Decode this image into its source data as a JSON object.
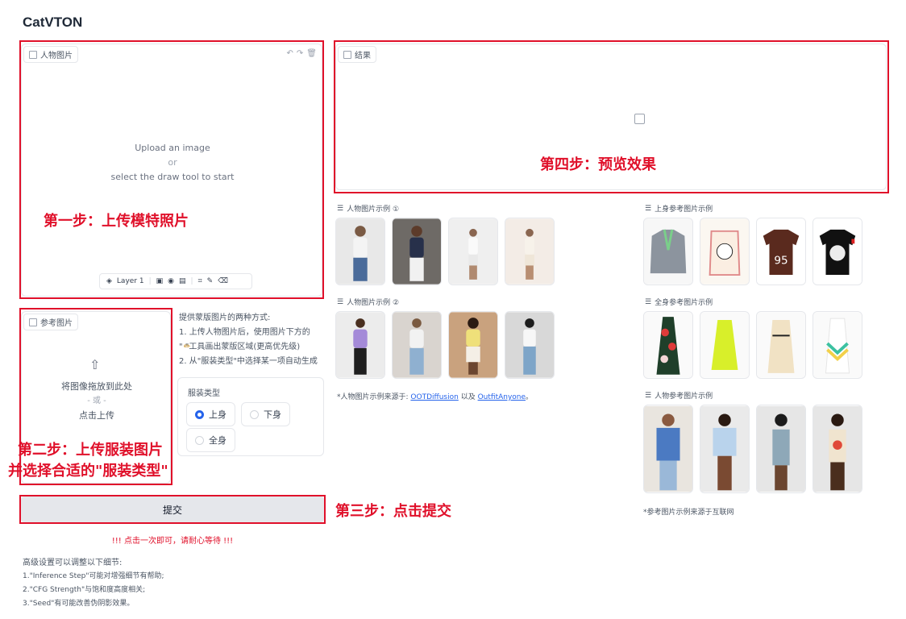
{
  "app": {
    "title": "CatVTON"
  },
  "person_panel": {
    "label": "人物图片",
    "upload_line1": "Upload an image",
    "upload_or": "or",
    "upload_line2": "select the draw tool to start",
    "layer_label": "Layer 1"
  },
  "result_panel": {
    "label": "结果"
  },
  "cloth_panel": {
    "label": "参考图片",
    "drop_text": "将图像拖放到此处",
    "or_text": "- 或 -",
    "click_text": "点击上传"
  },
  "mask_help": {
    "line1": "提供蒙版图片的两种方式:",
    "line2": "1. 上传人物图片后，使用图片下方的",
    "line3": "\"  \"工具画出蒙版区域(更高优先级)",
    "line4": "2. 从\"服装类型\"中选择某一项自动生成"
  },
  "cloth_type": {
    "label": "服装类型",
    "options": [
      "上身",
      "下身",
      "全身"
    ],
    "selected": "上身"
  },
  "submit": {
    "label": "提交",
    "note": "!!! 点击一次即可，请耐心等待 !!!"
  },
  "advanced": {
    "line1": "高级设置可以调整以下细节:",
    "line2": "1.\"Inference Step\"可能对增强细节有帮助;",
    "line3": "2.\"CFG Strength\"与饱和度高度相关;",
    "line4": "3.\"Seed\"有可能改善伪阴影效果。"
  },
  "galleries": {
    "person1": "人物图片示例 ①",
    "person2": "人物图片示例 ②",
    "upper": "上身参考图片示例",
    "full": "全身参考图片示例",
    "person_ref": "人物参考图片示例"
  },
  "credits": {
    "person_prefix": "*人物图片示例来源于:",
    "link1": "OOTDiffusion",
    "mid": "以及",
    "link2": "OutfitAnyone",
    "end": "。",
    "ref": "*参考图片示例来源于互联网"
  },
  "annotations": {
    "step1": "第一步：上传模特照片",
    "step2a": "第二步：上传服装图片",
    "step2b": "并选择合适的\"服装类型\"",
    "step3": "第三步：点击提交",
    "step4": "第四步：预览效果"
  },
  "colors": {
    "annotation_red": "#e0102a",
    "accent_blue": "#2563eb",
    "link_blue": "#2563eb"
  }
}
